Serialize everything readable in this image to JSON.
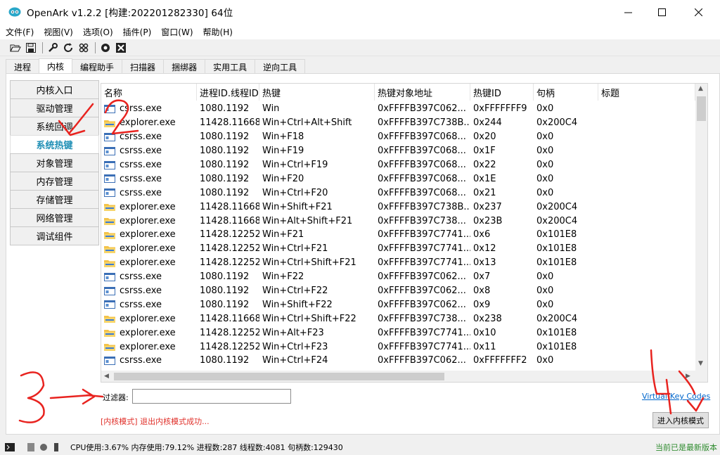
{
  "window": {
    "title": "OpenArk v1.2.2  [构建:202201282330]  64位"
  },
  "menu": [
    "文件(F)",
    "视图(V)",
    "选项(O)",
    "插件(P)",
    "窗口(W)",
    "帮助(H)"
  ],
  "toolbar_icons": [
    "folder-open-icon",
    "save-icon",
    "wrench-icon",
    "refresh-icon",
    "grid-icon",
    "target-icon",
    "close-box-icon"
  ],
  "tabs": [
    {
      "label": "进程",
      "active": false
    },
    {
      "label": "内核",
      "active": true
    },
    {
      "label": "编程助手",
      "active": false
    },
    {
      "label": "扫描器",
      "active": false
    },
    {
      "label": "捆绑器",
      "active": false
    },
    {
      "label": "实用工具",
      "active": false
    },
    {
      "label": "逆向工具",
      "active": false
    }
  ],
  "sidenav": [
    {
      "label": "内核入口",
      "active": false
    },
    {
      "label": "驱动管理",
      "active": false
    },
    {
      "label": "系统回调",
      "active": false
    },
    {
      "label": "系统热键",
      "active": true
    },
    {
      "label": "对象管理",
      "active": false
    },
    {
      "label": "内存管理",
      "active": false
    },
    {
      "label": "存储管理",
      "active": false
    },
    {
      "label": "网络管理",
      "active": false
    },
    {
      "label": "调试组件",
      "active": false
    }
  ],
  "columns": [
    "名称",
    "进程ID.线程ID",
    "热键",
    "热键对象地址",
    "热键ID",
    "句柄",
    "标题"
  ],
  "rows": [
    {
      "icon": "console",
      "name": "csrss.exe",
      "pid": "1080.1192",
      "hotkey": "Win",
      "addr": "0xFFFFB397C062...",
      "id": "0xFFFFFFF9",
      "hwnd": "0x0"
    },
    {
      "icon": "folder",
      "name": "explorer.exe",
      "pid": "11428.11668",
      "hotkey": "Win+Ctrl+Alt+Shift",
      "addr": "0xFFFFB397C738B...",
      "id": "0x244",
      "hwnd": "0x200C4"
    },
    {
      "icon": "console",
      "name": "csrss.exe",
      "pid": "1080.1192",
      "hotkey": "Win+F18",
      "addr": "0xFFFFB397C068...",
      "id": "0x20",
      "hwnd": "0x0"
    },
    {
      "icon": "console",
      "name": "csrss.exe",
      "pid": "1080.1192",
      "hotkey": "Win+F19",
      "addr": "0xFFFFB397C068...",
      "id": "0x1F",
      "hwnd": "0x0"
    },
    {
      "icon": "console",
      "name": "csrss.exe",
      "pid": "1080.1192",
      "hotkey": "Win+Ctrl+F19",
      "addr": "0xFFFFB397C068...",
      "id": "0x22",
      "hwnd": "0x0"
    },
    {
      "icon": "console",
      "name": "csrss.exe",
      "pid": "1080.1192",
      "hotkey": "Win+F20",
      "addr": "0xFFFFB397C068...",
      "id": "0x1E",
      "hwnd": "0x0"
    },
    {
      "icon": "console",
      "name": "csrss.exe",
      "pid": "1080.1192",
      "hotkey": "Win+Ctrl+F20",
      "addr": "0xFFFFB397C068...",
      "id": "0x21",
      "hwnd": "0x0"
    },
    {
      "icon": "folder",
      "name": "explorer.exe",
      "pid": "11428.11668",
      "hotkey": "Win+Shift+F21",
      "addr": "0xFFFFB397C738B...",
      "id": "0x237",
      "hwnd": "0x200C4"
    },
    {
      "icon": "folder",
      "name": "explorer.exe",
      "pid": "11428.11668",
      "hotkey": "Win+Alt+Shift+F21",
      "addr": "0xFFFFB397C738...",
      "id": "0x23B",
      "hwnd": "0x200C4"
    },
    {
      "icon": "folder",
      "name": "explorer.exe",
      "pid": "11428.12252",
      "hotkey": "Win+F21",
      "addr": "0xFFFFB397C7741...",
      "id": "0x6",
      "hwnd": "0x101E8"
    },
    {
      "icon": "folder",
      "name": "explorer.exe",
      "pid": "11428.12252",
      "hotkey": "Win+Ctrl+F21",
      "addr": "0xFFFFB397C7741...",
      "id": "0x12",
      "hwnd": "0x101E8"
    },
    {
      "icon": "folder",
      "name": "explorer.exe",
      "pid": "11428.12252",
      "hotkey": "Win+Ctrl+Shift+F21",
      "addr": "0xFFFFB397C7741...",
      "id": "0x13",
      "hwnd": "0x101E8"
    },
    {
      "icon": "console",
      "name": "csrss.exe",
      "pid": "1080.1192",
      "hotkey": "Win+F22",
      "addr": "0xFFFFB397C062...",
      "id": "0x7",
      "hwnd": "0x0"
    },
    {
      "icon": "console",
      "name": "csrss.exe",
      "pid": "1080.1192",
      "hotkey": "Win+Ctrl+F22",
      "addr": "0xFFFFB397C062...",
      "id": "0x8",
      "hwnd": "0x0"
    },
    {
      "icon": "console",
      "name": "csrss.exe",
      "pid": "1080.1192",
      "hotkey": "Win+Shift+F22",
      "addr": "0xFFFFB397C062...",
      "id": "0x9",
      "hwnd": "0x0"
    },
    {
      "icon": "folder",
      "name": "explorer.exe",
      "pid": "11428.11668",
      "hotkey": "Win+Ctrl+Shift+F22",
      "addr": "0xFFFFB397C738...",
      "id": "0x238",
      "hwnd": "0x200C4"
    },
    {
      "icon": "folder",
      "name": "explorer.exe",
      "pid": "11428.12252",
      "hotkey": "Win+Alt+F23",
      "addr": "0xFFFFB397C7741...",
      "id": "0x10",
      "hwnd": "0x101E8"
    },
    {
      "icon": "folder",
      "name": "explorer.exe",
      "pid": "11428.12252",
      "hotkey": "Win+Ctrl+F23",
      "addr": "0xFFFFB397C7741...",
      "id": "0x11",
      "hwnd": "0x101E8"
    },
    {
      "icon": "console",
      "name": "csrss.exe",
      "pid": "1080.1192",
      "hotkey": "Win+Ctrl+F24",
      "addr": "0xFFFFB397C062...",
      "id": "0xFFFFFFF2",
      "hwnd": "0x0"
    }
  ],
  "filter": {
    "label": "过滤器:",
    "value": ""
  },
  "vk_link": "Virtual-Key Codes",
  "status_message": "[内核模式] 退出内核模式成功...",
  "enter_button": "进入内核模式",
  "statusbar": {
    "cpu": "CPU使用:3.67%",
    "mem": "内存使用:79.12%",
    "procs": "进程数:287",
    "threads": "线程数:4081",
    "handles": "句柄数:129430",
    "update": "当前已是最新版本"
  },
  "annotation_colors": {
    "ink": "#e8231f"
  },
  "annotations": [
    "1",
    "2",
    "3",
    "4"
  ]
}
